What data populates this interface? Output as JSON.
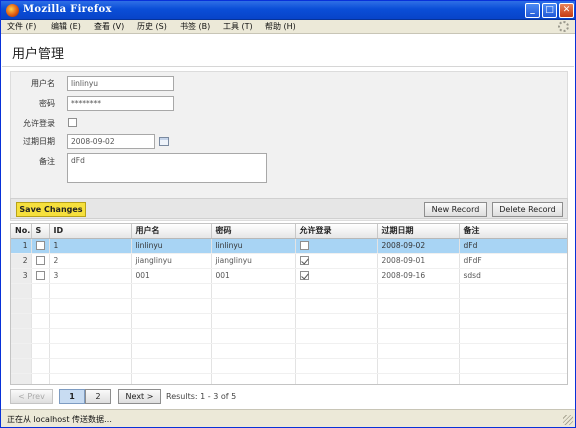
{
  "window": {
    "title": "Mozilla Firefox",
    "minimize": "_",
    "maximize": "□",
    "close": "✕"
  },
  "menu": [
    "文件 (F)",
    "编辑 (E)",
    "查看 (V)",
    "历史 (S)",
    "书签 (B)",
    "工具 (T)",
    "帮助 (H)"
  ],
  "page": {
    "title": "用户管理"
  },
  "form": {
    "username_label": "用户名",
    "username_value": "linlinyu",
    "password_label": "密码",
    "password_value": "********",
    "allow_login_label": "允许登录",
    "expire_label": "过期日期",
    "expire_value": "2008-09-02",
    "remark_label": "备注",
    "remark_value": "dFd"
  },
  "toolbar": {
    "save_label": "Save Changes",
    "new_label": "New Record",
    "delete_label": "Delete Record"
  },
  "grid": {
    "columns": [
      "No.",
      "S",
      "ID",
      "用户名",
      "密码",
      "允许登录",
      "过期日期",
      "备注"
    ],
    "rows": [
      {
        "no": "1",
        "id": "1",
        "username": "linlinyu",
        "password": "linlinyu",
        "allow_login": false,
        "expire": "2008-09-02",
        "remark": "dFd"
      },
      {
        "no": "2",
        "id": "2",
        "username": "jianglinyu",
        "password": "jianglinyu",
        "allow_login": true,
        "expire": "2008-09-01",
        "remark": "dFdF"
      },
      {
        "no": "3",
        "id": "3",
        "username": "001",
        "password": "001",
        "allow_login": true,
        "expire": "2008-09-16",
        "remark": "sdsd"
      }
    ],
    "selected_row": 0,
    "empty_rows": 7
  },
  "pager": {
    "prev_label": "< Prev",
    "pages": [
      "1",
      "2"
    ],
    "current_page": "1",
    "next_label": "Next >",
    "results_text": "Results: 1 - 3 of 5"
  },
  "status": {
    "text": "正在从 localhost 传送数据…"
  },
  "colors": {
    "titlebar": "#0a4ed7",
    "save_button": "#f6e03d",
    "selected_row": "#a8d4f4"
  }
}
